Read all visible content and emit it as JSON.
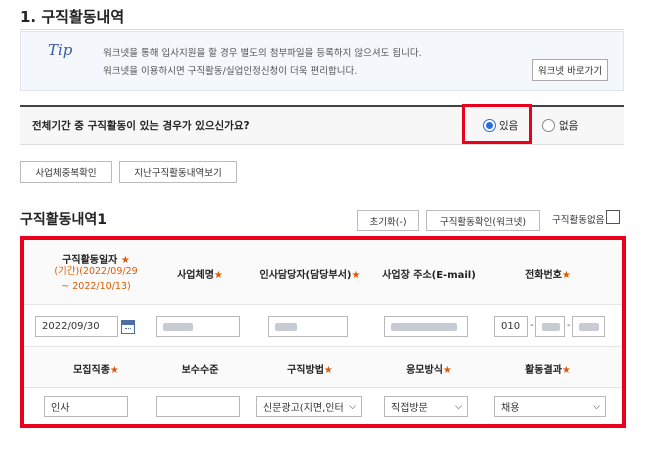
{
  "section": {
    "title": "1. 구직활동내역"
  },
  "tip": {
    "icon_text": "Tip",
    "line1": "워크넷을 통해 입사지원을 할 경우 별도의 첨부파일을 등록하지 않으셔도 됩니다.",
    "line2": "워크넷을 이용하시면 구직활동/실업인정신청이 더욱 편리합니다.",
    "link_button": "워크넷 바로가기"
  },
  "question": {
    "text": "전체기간 중 구직활동이 있는 경우가 있으신가요?",
    "options": [
      {
        "label": "있음",
        "checked": true
      },
      {
        "label": "없음",
        "checked": false
      }
    ]
  },
  "buttons": {
    "dup_check": "사업체중복확인",
    "prev_history": "지난구직활동내역보기"
  },
  "history": {
    "title": "구직활동내역1",
    "reset": "초기화(-)",
    "confirm_worknet": "구직활동확인(워크넷)",
    "no_activity": "구직활동없음"
  },
  "form": {
    "row1_headers": {
      "date": "구직활동일자",
      "date_period": "(기간)(2022/09/29",
      "date_period2": "~ 2022/10/13)",
      "company": "사업체명",
      "manager": "인사담당자(담당부서)",
      "address": "사업장 주소(E-mail)",
      "phone": "전화번호"
    },
    "row2_values": {
      "date": "2022/09/30",
      "phone_prefix": "010"
    },
    "row3_headers": {
      "job_type": "모집직종",
      "salary": "보수수준",
      "method": "구직방법",
      "apply_type": "응모방식",
      "result": "활동결과"
    },
    "row4_values": {
      "job_type": "인사",
      "salary": "",
      "method": "신문광고(지면,인터",
      "apply_type": "직접방문",
      "result": "채용"
    },
    "required_mark": "★"
  },
  "colors": {
    "highlight": "#e8001c",
    "required": "#e05a00",
    "radio_checked": "#2d6cd9"
  },
  "icons": [
    "tip-icon",
    "calendar-icon",
    "chevron-down-icon",
    "checkbox-icon"
  ]
}
